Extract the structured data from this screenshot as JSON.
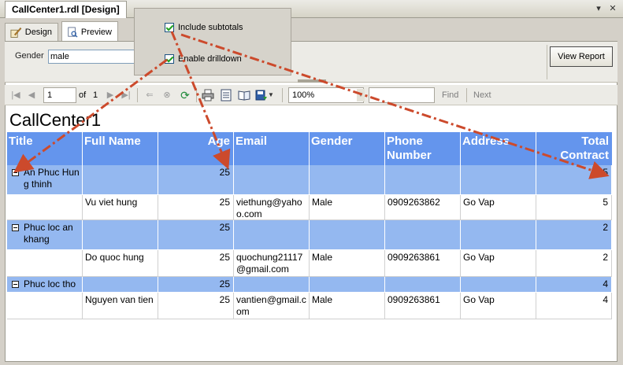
{
  "window": {
    "doc_tab": "CallCenter1.rdl [Design]",
    "close_glyph": "✕",
    "pin_glyph": "▾"
  },
  "view_tabs": [
    {
      "label": "Design",
      "icon": "design-icon",
      "active": false
    },
    {
      "label": "Preview",
      "icon": "preview-icon",
      "active": true
    }
  ],
  "params": {
    "gender_label": "Gender",
    "gender_value": "male",
    "view_report_label": "View Report"
  },
  "options": {
    "include_subtotals_label": "Include subtotals",
    "include_subtotals_checked": true,
    "enable_drilldown_label": "Enable drilldown",
    "enable_drilldown_checked": true
  },
  "toolbar": {
    "page_value": "1",
    "of_label": "of",
    "page_count": "1",
    "zoom_value": "100%",
    "find_label": "Find",
    "next_label": "Next",
    "icons": [
      "first-page-icon",
      "prev-page-icon",
      "next-page-icon",
      "last-page-icon",
      "back-icon",
      "stop-icon",
      "refresh-icon",
      "print-icon",
      "print-layout-icon",
      "page-setup-icon",
      "export-icon"
    ]
  },
  "report": {
    "title": "CallCenter1",
    "columns": [
      "Title",
      "Full Name",
      "Age",
      "Email",
      "Gender",
      "Phone Number",
      "Address",
      "Total Contract"
    ],
    "groups": [
      {
        "title": "An Phuc Hung thinh",
        "age": "25",
        "total": "5",
        "detail": {
          "full_name": "Vu viet hung",
          "age": "25",
          "email": "viethung@yahoo.com",
          "gender": "Male",
          "phone": "0909263862",
          "address": "Go Vap",
          "total": "5"
        }
      },
      {
        "title": "Phuc loc an khang",
        "age": "25",
        "total": "2",
        "detail": {
          "full_name": "Do quoc hung",
          "age": "25",
          "email": "quochung21117@gmail.com",
          "gender": "Male",
          "phone": "0909263861",
          "address": "Go Vap",
          "total": "2"
        }
      },
      {
        "title": "Phuc loc tho",
        "age": "25",
        "total": "4",
        "detail": {
          "full_name": "Nguyen van tien",
          "age": "25",
          "email": "vantien@gmail.com",
          "gender": "Male",
          "phone": "0909263861",
          "address": "Go Vap",
          "total": "4"
        }
      }
    ]
  },
  "colors": {
    "header_blue": "#6495ed",
    "group_blue": "#94b8f0",
    "arrow_red": "#cc4a2c"
  }
}
